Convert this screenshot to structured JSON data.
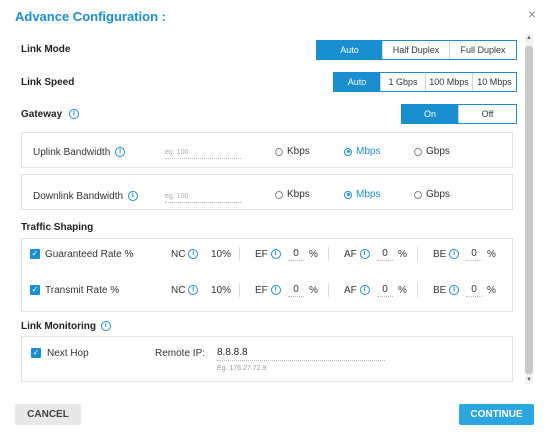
{
  "dialog": {
    "title": "Advance Configuration :",
    "close_glyph": "×"
  },
  "link_mode": {
    "label": "Link Mode",
    "options": [
      "Auto",
      "Half Duplex",
      "Full Duplex"
    ],
    "selected": "Auto"
  },
  "link_speed": {
    "label": "Link Speed",
    "options": [
      "Auto",
      "1 Gbps",
      "100 Mbps",
      "10 Mbps"
    ],
    "selected": "Auto"
  },
  "gateway": {
    "label": "Gateway",
    "options": [
      "On",
      "Off"
    ],
    "selected": "On"
  },
  "uplink": {
    "label": "Uplink Bandwidth",
    "placeholder": "eg. 100",
    "units": [
      "Kbps",
      "Mbps",
      "Gbps"
    ],
    "selected": "Mbps"
  },
  "downlink": {
    "label": "Downlink Bandwidth",
    "placeholder": "eg. 100",
    "units": [
      "Kbps",
      "Mbps",
      "Gbps"
    ],
    "selected": "Mbps"
  },
  "traffic_shaping": {
    "label": "Traffic Shaping",
    "rows": [
      {
        "label": "Guaranteed Rate %",
        "nc_label": "NC",
        "nc_value": "10%",
        "ef_label": "EF",
        "ef_value": "0",
        "af_label": "AF",
        "af_value": "0",
        "be_label": "BE",
        "be_value": "0",
        "pct": "%"
      },
      {
        "label": "Transmit Rate %",
        "nc_label": "NC",
        "nc_value": "10%",
        "ef_label": "EF",
        "ef_value": "0",
        "af_label": "AF",
        "af_value": "0",
        "be_label": "BE",
        "be_value": "0",
        "pct": "%"
      }
    ]
  },
  "link_monitoring": {
    "label": "Link Monitoring",
    "next_hop_label": "Next Hop",
    "remote_ip_label": "Remote IP:",
    "remote_ip_value": "8.8.8.8",
    "remote_ip_hint": "Eg. 176.27.72.9"
  },
  "footer": {
    "cancel_label": "CANCEL",
    "continue_label": "CONTINUE"
  },
  "colors": {
    "accent": "#1a8fd0",
    "continue_bg": "#2aa6e0"
  }
}
